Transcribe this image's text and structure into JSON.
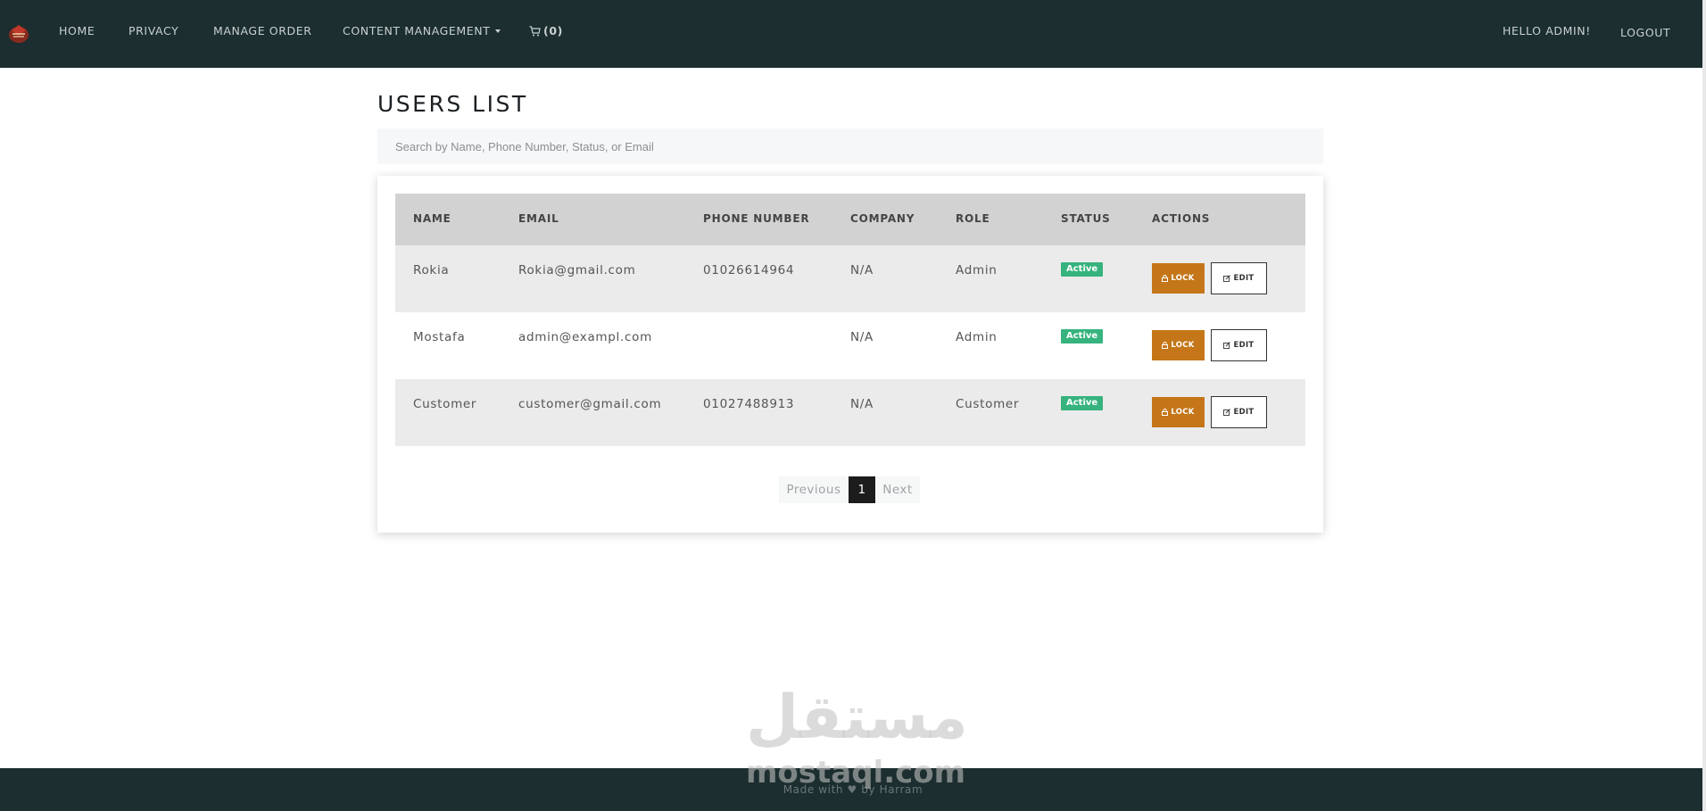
{
  "navbar": {
    "items": [
      {
        "label": "HOME"
      },
      {
        "label": "PRIVACY"
      },
      {
        "label": "MANAGE ORDER"
      },
      {
        "label": "CONTENT MANAGEMENT"
      }
    ],
    "cart_label": "(0)",
    "greeting": "HELLO ADMIN!",
    "logout": "LOGOUT"
  },
  "page": {
    "title": "USERS LIST",
    "search_placeholder": "Search by Name, Phone Number, Status, or Email"
  },
  "table": {
    "headers": [
      "NAME",
      "EMAIL",
      "PHONE NUMBER",
      "COMPANY",
      "ROLE",
      "STATUS",
      "ACTIONS"
    ],
    "rows": [
      {
        "name": "Rokia",
        "email": "Rokia@gmail.com",
        "phone": "01026614964",
        "company": "N/A",
        "role": "Admin",
        "status": "Active"
      },
      {
        "name": "Mostafa",
        "email": "admin@exampl.com",
        "phone": "",
        "company": "N/A",
        "role": "Admin",
        "status": "Active"
      },
      {
        "name": "Customer",
        "email": "customer@gmail.com",
        "phone": "01027488913",
        "company": "N/A",
        "role": "Customer",
        "status": "Active"
      }
    ],
    "lock_label": "LOCK",
    "edit_label": "EDIT"
  },
  "pagination": {
    "previous": "Previous",
    "current": "1",
    "next": "Next"
  },
  "footer": {
    "text": "Made with ♥ by Harram"
  },
  "watermark": {
    "arabic": "مستقل",
    "latin": "mostaql.com"
  },
  "colors": {
    "navbar_bg": "#1c2e2f",
    "lock_button": "#c47618",
    "status_active": "#36b37e",
    "header_row": "#d2d2d2"
  }
}
